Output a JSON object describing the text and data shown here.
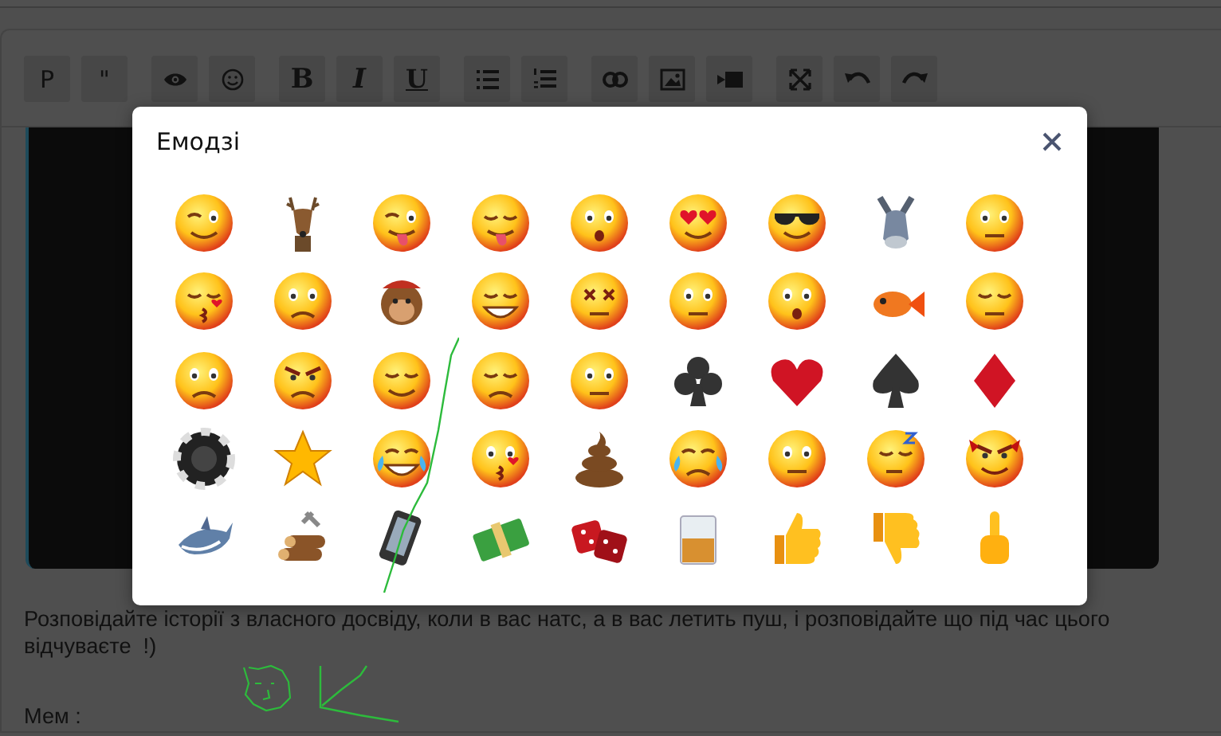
{
  "editor": {
    "toolbar": [
      {
        "kind": "text",
        "label": "P"
      },
      {
        "kind": "text",
        "label": "\""
      },
      {
        "kind": "icon"
      },
      {
        "kind": "icon"
      },
      {
        "kind": "text",
        "label": "B"
      },
      {
        "kind": "text",
        "label": "I"
      },
      {
        "kind": "text",
        "label": "U"
      },
      {
        "kind": "icon"
      },
      {
        "kind": "icon"
      },
      {
        "kind": "icon"
      },
      {
        "kind": "icon"
      },
      {
        "kind": "icon"
      },
      {
        "kind": "icon"
      },
      {
        "kind": "icon"
      },
      {
        "kind": "icon"
      }
    ],
    "paragraphs": [
      "Розповідайте історії з власного досвіду, коли в вас натс, а в вас летить пуш, і розповідайте що під час цього відчуваєте  !)",
      "Мем :"
    ]
  },
  "dialog": {
    "title": "Емодзі"
  }
}
